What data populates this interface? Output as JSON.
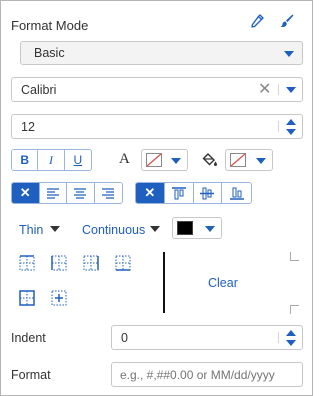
{
  "header": {
    "title": "Format Mode",
    "icons": [
      "eyedropper-icon",
      "brush-icon"
    ]
  },
  "format_mode": {
    "value": "Basic"
  },
  "font": {
    "family": "Calibri",
    "size": "12"
  },
  "style_buttons": {
    "bold": "B",
    "italic": "I",
    "underline": "U",
    "font_color_glyph": "A"
  },
  "alignment": {
    "horizontal_selected": "none",
    "vertical_selected": "none"
  },
  "border": {
    "weight": "Thin",
    "style": "Continuous",
    "color": "#000000",
    "clear_label": "Clear"
  },
  "indent": {
    "label": "Indent",
    "value": "0"
  },
  "format": {
    "label": "Format",
    "value": "",
    "placeholder": "e.g., #,##0.00 or MM/dd/yyyy"
  },
  "colors": {
    "accent": "#1f5fbf",
    "border": "#c8c8c8",
    "no_color_slash": "#d9534f"
  }
}
